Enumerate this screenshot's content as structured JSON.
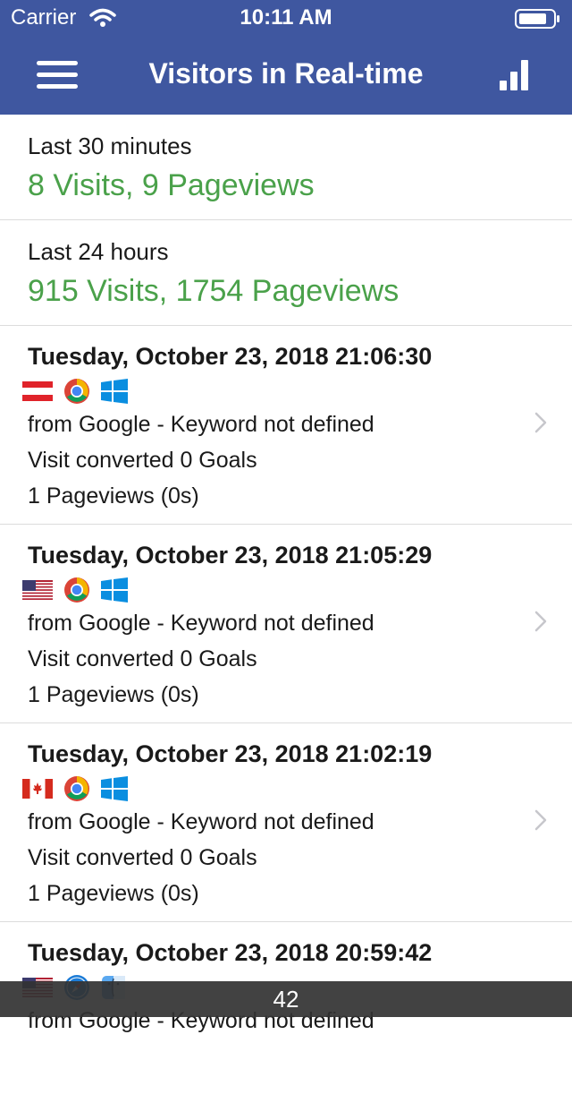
{
  "status_bar": {
    "carrier": "Carrier",
    "time": "10:11 AM"
  },
  "header": {
    "title": "Visitors in Real-time",
    "menu_icon": "hamburger-menu-icon",
    "chart_icon": "bar-chart-icon"
  },
  "summary": [
    {
      "label": "Last 30 minutes",
      "value": "8 Visits, 9 Pageviews"
    },
    {
      "label": "Last 24 hours",
      "value": "915 Visits, 1754 Pageviews"
    }
  ],
  "visits": [
    {
      "time": "Tuesday, October 23, 2018 21:06:30",
      "country": "Austria",
      "browser": "Chrome",
      "os": "Windows",
      "referrer": "from Google - Keyword not defined",
      "goals": "Visit converted 0 Goals",
      "pageviews": "1 Pageviews (0s)"
    },
    {
      "time": "Tuesday, October 23, 2018 21:05:29",
      "country": "United States",
      "browser": "Chrome",
      "os": "Windows",
      "referrer": "from Google - Keyword not defined",
      "goals": "Visit converted 0 Goals",
      "pageviews": "1 Pageviews (0s)"
    },
    {
      "time": "Tuesday, October 23, 2018 21:02:19",
      "country": "Canada",
      "browser": "Chrome",
      "os": "Windows",
      "referrer": "from Google - Keyword not defined",
      "goals": "Visit converted 0 Goals",
      "pageviews": "1 Pageviews (0s)"
    },
    {
      "time": "Tuesday, October 23, 2018 20:59:42",
      "country": "United States",
      "browser": "Safari",
      "os": "Mac",
      "referrer": "from Google - Keyword not defined",
      "goals": "",
      "pageviews": ""
    }
  ],
  "toast": {
    "text": "42"
  },
  "colors": {
    "header": "#3f57a0",
    "accent_green": "#4aa14a"
  }
}
